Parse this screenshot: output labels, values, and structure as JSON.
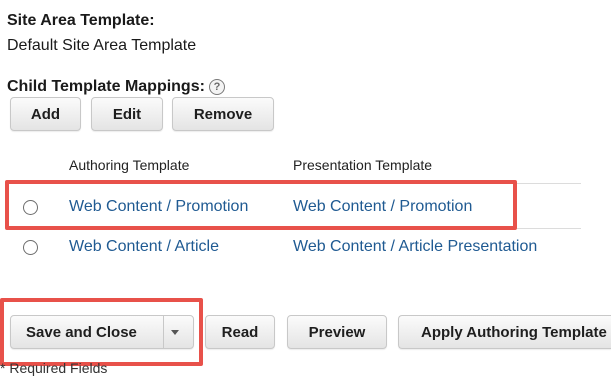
{
  "site_area_template": {
    "heading": "Site Area Template:",
    "value": "Default Site Area Template"
  },
  "child_mappings": {
    "heading": "Child Template Mappings:",
    "help_icon": "?",
    "buttons": {
      "add": "Add",
      "edit": "Edit",
      "remove": "Remove"
    },
    "table": {
      "columns": [
        "Authoring Template",
        "Presentation Template"
      ],
      "rows": [
        {
          "authoring": "Web Content / Promotion",
          "presentation": "Web Content / Promotion",
          "highlighted": true
        },
        {
          "authoring": "Web Content / Article",
          "presentation": "Web Content / Article Presentation",
          "highlighted": false
        }
      ]
    }
  },
  "footer_actions": {
    "save_and_close": "Save and Close",
    "read": "Read",
    "preview": "Preview",
    "apply_authoring_template": "Apply Authoring Template"
  },
  "required_note": "* Required Fields",
  "colors": {
    "link": "#1f5a92",
    "highlight_border": "#e8514a"
  }
}
